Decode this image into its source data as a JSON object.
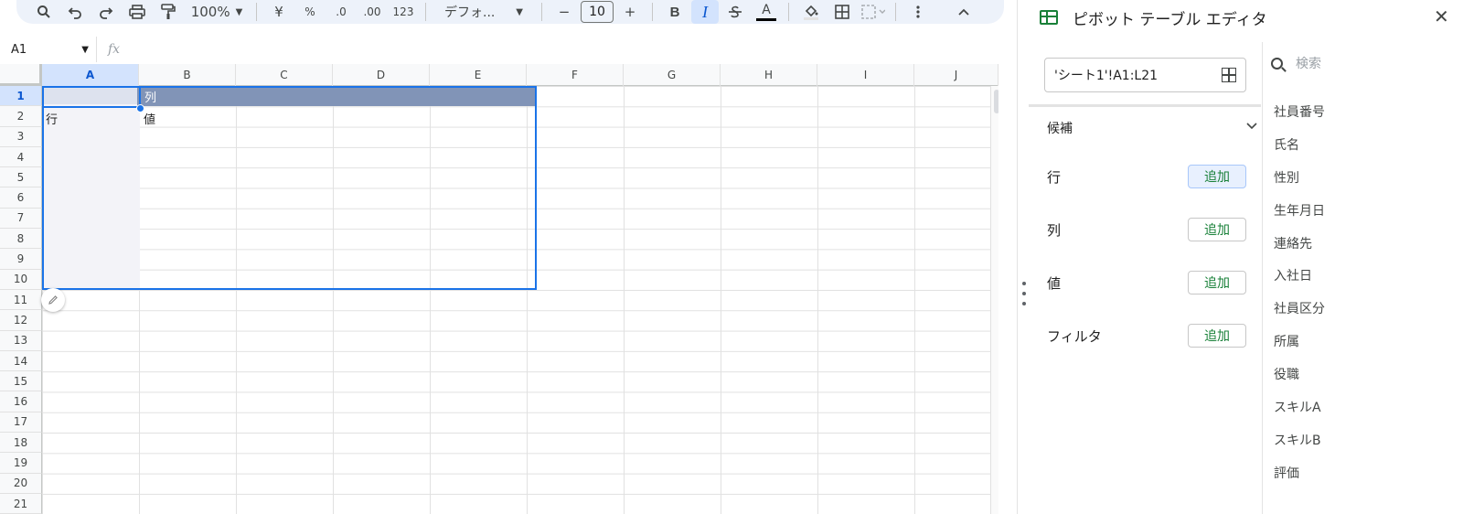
{
  "toolbar": {
    "zoom": "100%",
    "currency": "¥",
    "percent": "%",
    "decrease_decimal": ".0",
    "increase_decimal": ".00",
    "number_format": "123",
    "font": "デフォ...",
    "font_size": "10",
    "bold": "B",
    "italic": "I",
    "text_color": "A"
  },
  "formula_bar": {
    "name_box": "A1",
    "fx": "fx"
  },
  "grid": {
    "columns": [
      "A",
      "B",
      "C",
      "D",
      "E",
      "F",
      "G",
      "H",
      "I",
      "J"
    ],
    "rows": [
      "1",
      "2",
      "3",
      "4",
      "5",
      "6",
      "7",
      "8",
      "9",
      "10",
      "11",
      "12",
      "13",
      "14",
      "15",
      "16",
      "17",
      "18",
      "19",
      "20",
      "21"
    ],
    "cells": {
      "B1": "列",
      "A2": "行",
      "B2": "値"
    }
  },
  "panel": {
    "title": "ピボット テーブル エディタ",
    "range": "'シート1'!A1:L21",
    "suggestions_label": "候補",
    "sections": [
      {
        "label": "行",
        "add": "追加"
      },
      {
        "label": "列",
        "add": "追加"
      },
      {
        "label": "値",
        "add": "追加"
      },
      {
        "label": "フィルタ",
        "add": "追加"
      }
    ],
    "search_placeholder": "検索",
    "fields": [
      "社員番号",
      "氏名",
      "性別",
      "生年月日",
      "連絡先",
      "入社日",
      "社員区分",
      "所属",
      "役職",
      "スキルA",
      "スキルB",
      "評価"
    ]
  },
  "colors": {
    "accent": "#1a73e8",
    "pivot_header": "#8194b7",
    "add_green": "#188038"
  }
}
